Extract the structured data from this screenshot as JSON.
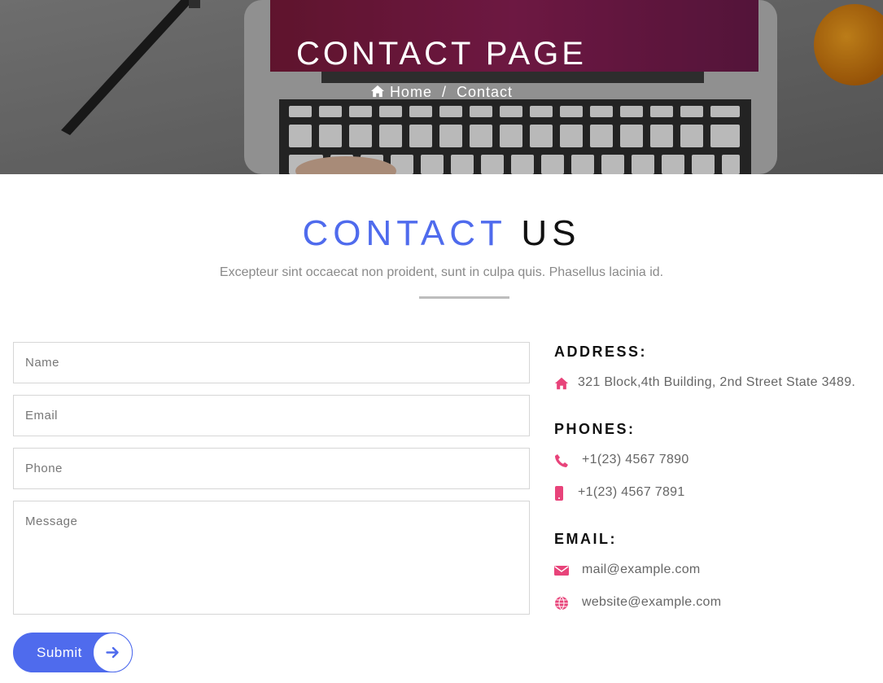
{
  "hero": {
    "title": "CONTACT PAGE",
    "breadcrumb": {
      "home": "Home",
      "separator": "/",
      "current": "Contact"
    }
  },
  "section": {
    "title_accent": "CONTACT",
    "title_dark": "US",
    "subtitle": "Excepteur sint occaecat non proident, sunt in culpa quis. Phasellus lacinia id."
  },
  "form": {
    "name_placeholder": "Name",
    "email_placeholder": "Email",
    "phone_placeholder": "Phone",
    "message_placeholder": "Message",
    "submit_label": "Submit"
  },
  "info": {
    "address_heading": "ADDRESS:",
    "address": "321 Block,4th Building, 2nd Street State 3489.",
    "phones_heading": "PHONES:",
    "phone_1": "+1(23) 4567 7890",
    "phone_2": "+1(23) 4567 7891",
    "email_heading": "EMAIL:",
    "email": "mail@example.com",
    "website": "website@example.com"
  },
  "icons": {
    "breadcrumb": "home-icon",
    "address": "home-icon",
    "phone_1": "phone-icon",
    "phone_2": "mobile-icon",
    "email": "envelope-icon",
    "website": "globe-icon",
    "submit": "arrow-right-icon"
  },
  "colors": {
    "accent": "#4f6bed",
    "icon": "#e8437a",
    "heading": "#111111",
    "muted": "#8a8a8a"
  }
}
